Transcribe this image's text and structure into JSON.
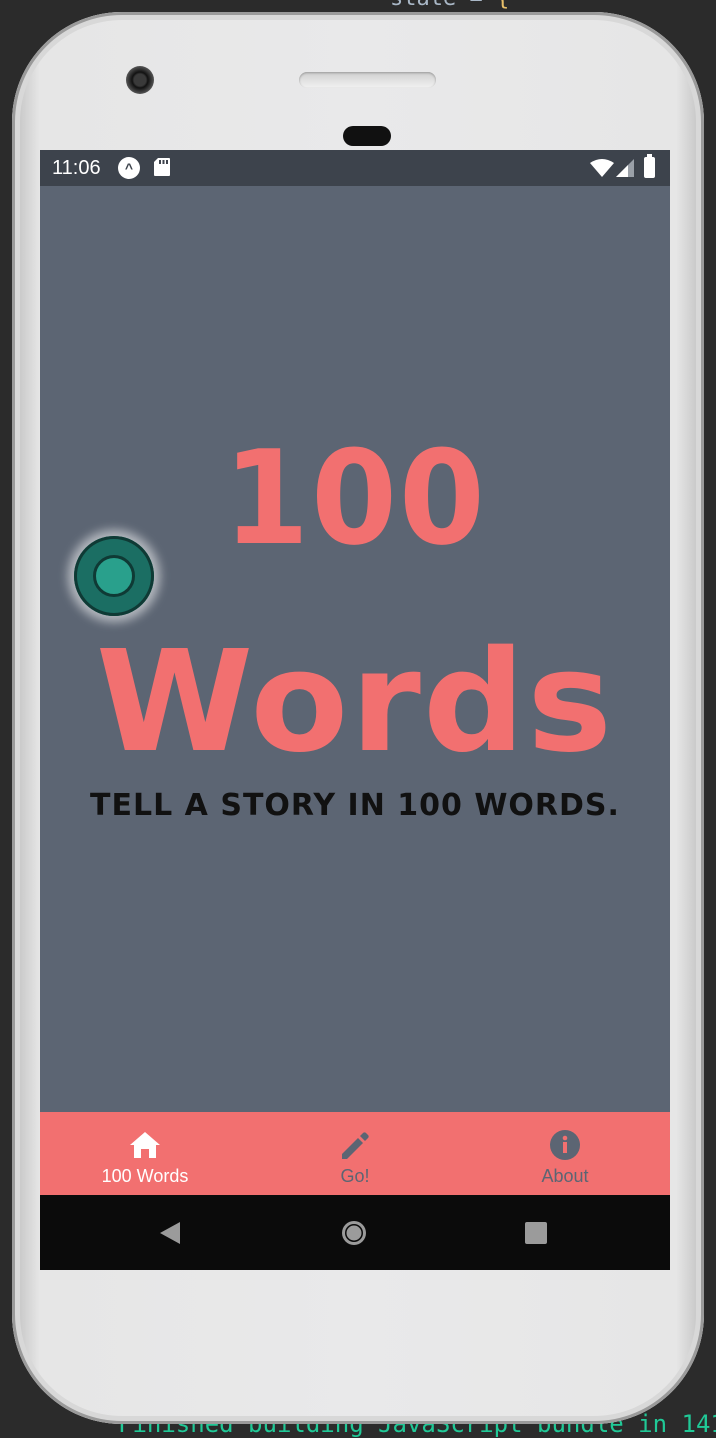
{
  "status_bar": {
    "time": "11:06"
  },
  "app": {
    "title_line_1": "100",
    "title_line_2": "Words",
    "tagline": "TELL A STORY IN 100 WORDS."
  },
  "tabs": [
    {
      "label": "100 Words",
      "icon": "home-icon",
      "active": true
    },
    {
      "label": "Go!",
      "icon": "pencil-icon",
      "active": false
    },
    {
      "label": "About",
      "icon": "info-icon",
      "active": false
    }
  ],
  "colors": {
    "screen_background": "#5c6573",
    "accent": "#f27070",
    "status_bar": "#3d434c",
    "tab_active": "#ffffff",
    "tab_inactive": "#5c6573",
    "nav_bar": "#0b0b0b"
  }
}
